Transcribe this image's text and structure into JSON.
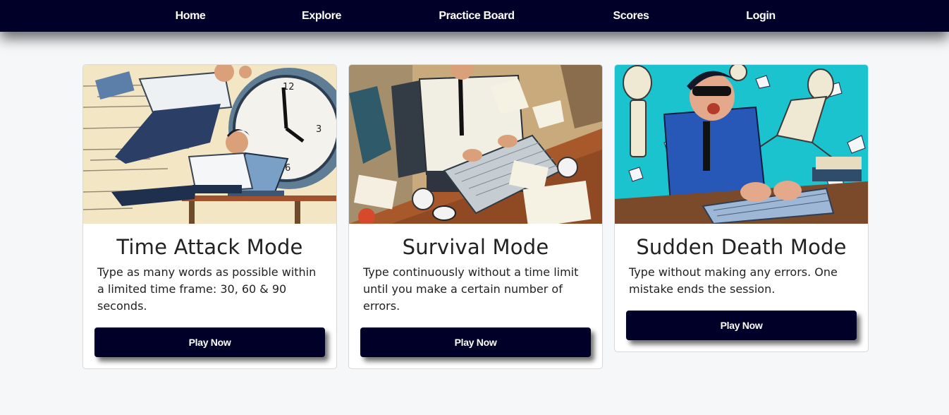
{
  "nav": {
    "home": "Home",
    "explore": "Explore",
    "practice_board": "Practice Board",
    "scores": "Scores",
    "login": "Login"
  },
  "cards": [
    {
      "title": "Time Attack Mode",
      "description": "Type as many words as possible within a limited time frame: 30, 60 & 90 seconds.",
      "button": "Play Now",
      "image_icon": "time-attack-illustration"
    },
    {
      "title": "Survival Mode",
      "description": "Type continuously without a time limit until you make a certain number of errors.",
      "button": "Play Now",
      "image_icon": "survival-illustration"
    },
    {
      "title": "Sudden Death Mode",
      "description": "Type without making any errors. One mistake ends the session.",
      "button": "Play Now",
      "image_icon": "sudden-death-illustration"
    }
  ],
  "colors": {
    "navbar": "#000028",
    "background": "#f6f7f9",
    "button": "#000028",
    "card_border": "#d8d8d8"
  }
}
